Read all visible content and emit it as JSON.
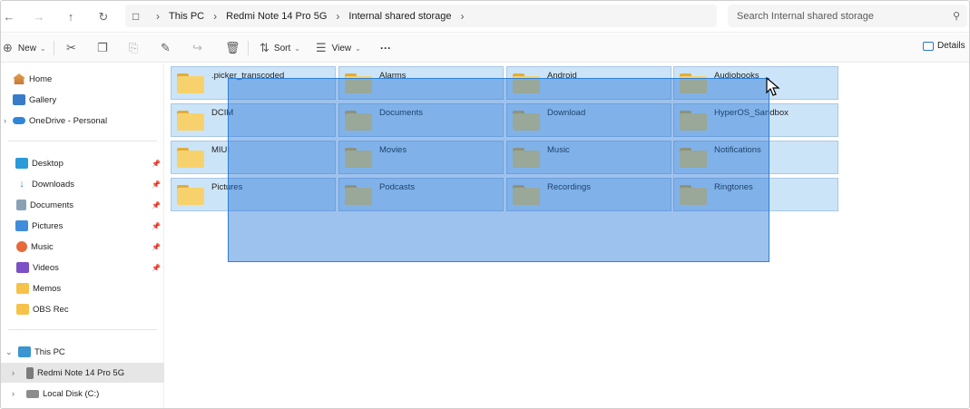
{
  "address": {
    "crumbs": [
      "This PC",
      "Redmi Note 14 Pro 5G",
      "Internal shared storage"
    ]
  },
  "search": {
    "placeholder": "Search Internal shared storage"
  },
  "toolbar": {
    "new_label": "New",
    "sort_label": "Sort",
    "view_label": "View",
    "more_label": "···",
    "details_label": "Details"
  },
  "sidebar": {
    "top": [
      {
        "label": "Home",
        "icon": "home-icon"
      },
      {
        "label": "Gallery",
        "icon": "gallery-icon"
      },
      {
        "label": "OneDrive - Personal",
        "icon": "onedrive-icon"
      }
    ],
    "quick": [
      {
        "label": "Desktop",
        "icon": "desktop-icon",
        "pinned": true
      },
      {
        "label": "Downloads",
        "icon": "downloads-icon",
        "pinned": true
      },
      {
        "label": "Documents",
        "icon": "documents-icon",
        "pinned": true
      },
      {
        "label": "Pictures",
        "icon": "pictures-icon",
        "pinned": true
      },
      {
        "label": "Music",
        "icon": "music-icon",
        "pinned": true
      },
      {
        "label": "Videos",
        "icon": "videos-icon",
        "pinned": true
      },
      {
        "label": "Memos",
        "icon": "folder-icon",
        "pinned": false
      },
      {
        "label": "OBS Rec",
        "icon": "folder-icon",
        "pinned": false
      }
    ],
    "devices": [
      {
        "label": "This PC",
        "icon": "this-pc-icon"
      },
      {
        "label": "Redmi Note 14 Pro 5G",
        "icon": "phone-icon"
      },
      {
        "label": "Local Disk (C:)",
        "icon": "disk-icon"
      }
    ]
  },
  "folders": [
    ".picker_transcoded",
    "Alarms",
    "Android",
    "Audiobooks",
    "DCIM",
    "Documents",
    "Download",
    "HyperOS_Sandbox",
    "MIUI",
    "Movies",
    "Music",
    "Notifications",
    "Pictures",
    "Podcasts",
    "Recordings",
    "Ringtones"
  ],
  "colors": {
    "selection": "#1f6ed4",
    "tile_selected": "#cce4f7",
    "folder": "#f7d26c"
  }
}
